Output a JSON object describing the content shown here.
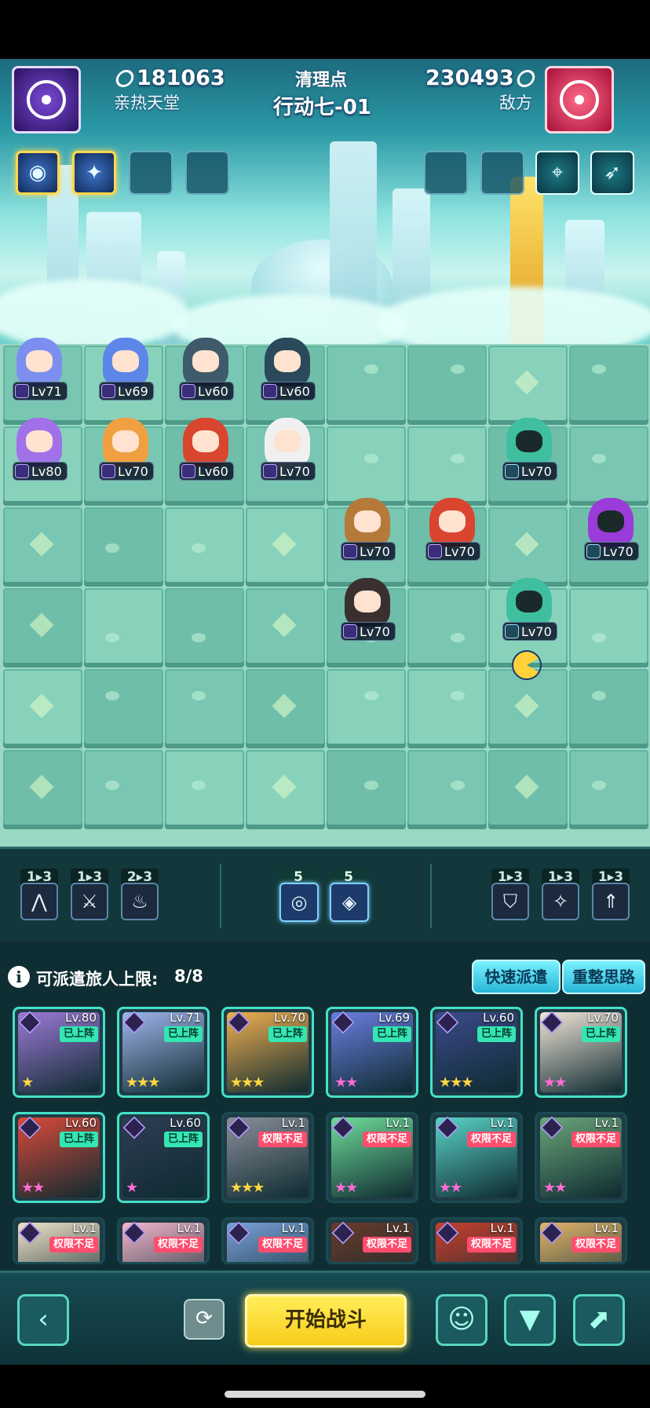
{
  "header": {
    "player_power": "181063",
    "player_name": "亲热天堂",
    "stage_type": "清理点",
    "stage_name": "行动七-01",
    "enemy_power": "230493",
    "enemy_label": "敌方"
  },
  "player_buffs": [
    "spiral-icon",
    "sparkle-icon",
    "empty-slot",
    "empty-slot"
  ],
  "enemy_buffs": [
    "empty-slot",
    "empty-slot",
    "crosshair-icon",
    "runner-icon"
  ],
  "board": {
    "player_units": [
      {
        "level": "Lv71",
        "color": "#7c8ff0"
      },
      {
        "level": "Lv69",
        "color": "#5d86e8"
      },
      {
        "level": "Lv60",
        "color": "#3f5a6a"
      },
      {
        "level": "Lv60",
        "color": "#2a4a5c"
      },
      {
        "level": "Lv80",
        "color": "#a071e8"
      },
      {
        "level": "Lv70",
        "color": "#f0a040"
      },
      {
        "level": "Lv60",
        "color": "#d9452f"
      },
      {
        "level": "Lv70",
        "color": "#f0f0f0"
      },
      {
        "level": "Lv70",
        "color": "#b57a3a"
      },
      {
        "level": "Lv70",
        "color": "#d9452f"
      },
      {
        "level": "Lv70",
        "color": "#3a3030"
      }
    ],
    "enemy_units": [
      {
        "level": "Lv70",
        "color": "#3fbfa0"
      },
      {
        "level": "Lv70",
        "color": "#9b3bd9"
      },
      {
        "level": "Lv70",
        "color": "#3fbfa0"
      }
    ]
  },
  "class_bar": {
    "left": [
      {
        "count": "1▸3",
        "icon": "mountain-icon"
      },
      {
        "count": "1▸3",
        "icon": "dagger-icon"
      },
      {
        "count": "2▸3",
        "icon": "flame-icon"
      }
    ],
    "middle": [
      {
        "count": "5",
        "icon": "swirl-icon"
      },
      {
        "count": "5",
        "icon": "diamond-icon"
      }
    ],
    "right": [
      {
        "count": "1▸3",
        "icon": "shield-icon"
      },
      {
        "count": "1▸3",
        "icon": "star-icon"
      },
      {
        "count": "1▸3",
        "icon": "arrow-up-icon"
      }
    ]
  },
  "roster": {
    "deploy_label": "可派遣旅人上限:",
    "deploy_count": "8/8",
    "quick_deploy": "快速派遣",
    "reset": "重整思路",
    "cards": [
      {
        "level": "Lv.80",
        "tag": "已上阵",
        "stars": "★",
        "art": "#9d7ad8"
      },
      {
        "level": "Lv.71",
        "tag": "已上阵",
        "stars": "★★★",
        "art": "#9fb6ec"
      },
      {
        "level": "Lv.70",
        "tag": "已上阵",
        "stars": "★★★",
        "art": "#f0b050"
      },
      {
        "level": "Lv.69",
        "tag": "已上阵",
        "stars": "★★",
        "art": "#6a7ee0"
      },
      {
        "level": "Lv.60",
        "tag": "已上阵",
        "stars": "★★★",
        "art": "#3b4a8a"
      },
      {
        "level": "Lv.70",
        "tag": "已上阵",
        "stars": "★★",
        "art": "#f2e6d8"
      },
      {
        "level": "Lv.60",
        "tag": "已上阵",
        "stars": "★★",
        "art": "#d94a3a"
      },
      {
        "level": "Lv.60",
        "tag": "已上阵",
        "stars": "★",
        "art": "#2f3d55"
      },
      {
        "level": "Lv.1",
        "tag": "权限不足",
        "stars": "★★★",
        "art": "#8a8f9a"
      },
      {
        "level": "Lv.1",
        "tag": "权限不足",
        "stars": "★★",
        "art": "#6fdc9a"
      },
      {
        "level": "Lv.1",
        "tag": "权限不足",
        "stars": "★★",
        "art": "#5ad3c8"
      },
      {
        "level": "Lv.1",
        "tag": "权限不足",
        "stars": "★★",
        "art": "#6aa67a"
      },
      {
        "level": "Lv.1",
        "tag": "权限不足",
        "stars": "",
        "art": "#f0e2c8"
      },
      {
        "level": "Lv.1",
        "tag": "权限不足",
        "stars": "",
        "art": "#f4b6cc"
      },
      {
        "level": "Lv.1",
        "tag": "权限不足",
        "stars": "",
        "art": "#7aa0d8"
      },
      {
        "level": "Lv.1",
        "tag": "权限不足",
        "stars": "",
        "art": "#6a3a2a"
      },
      {
        "level": "Lv.1",
        "tag": "权限不足",
        "stars": "",
        "art": "#c9402e"
      },
      {
        "level": "Lv.1",
        "tag": "权限不足",
        "stars": "",
        "art": "#e2b46a"
      }
    ]
  },
  "bottom_bar": {
    "start_battle": "开始战斗",
    "back_icon": "‹",
    "swap_icon": "⟳",
    "brain_icon": "☺",
    "filter_icon": "▼",
    "sort_icon": "⬈"
  }
}
